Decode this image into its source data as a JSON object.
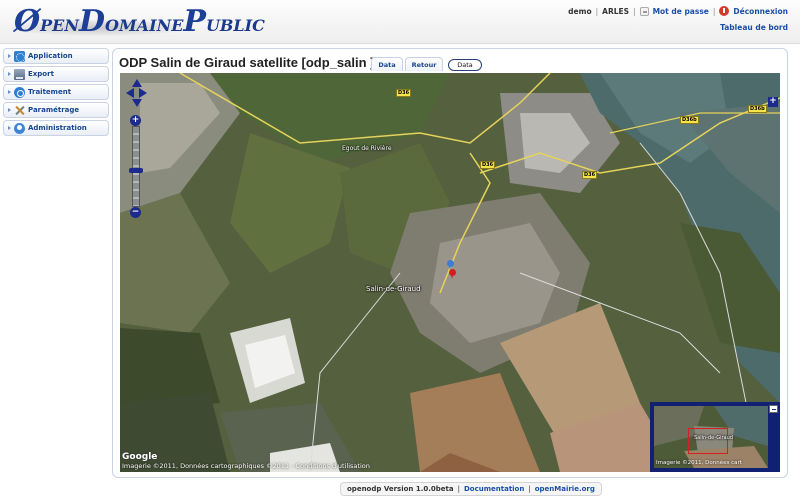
{
  "header": {
    "logo_text": "ØpenDomainePublic",
    "user": "demo",
    "city": "ARLES",
    "password_link": "Mot de passe",
    "logout_link": "Déconnexion",
    "dashboard_link": "Tableau de bord"
  },
  "sidebar": {
    "items": [
      {
        "label": "Application",
        "icon": "application-icon"
      },
      {
        "label": "Export",
        "icon": "export-icon"
      },
      {
        "label": "Traitement",
        "icon": "traitement-icon"
      },
      {
        "label": "Paramétrage",
        "icon": "tools-icon"
      },
      {
        "label": "Administration",
        "icon": "admin-icon"
      }
    ]
  },
  "main": {
    "title": "ODP Salin de Giraud satellite [odp_salin ]",
    "tabs": [
      {
        "label": "Data"
      },
      {
        "label": "Retour"
      }
    ],
    "data_button": "Data"
  },
  "map": {
    "road_labels": [
      "D36",
      "D36",
      "D36",
      "D36",
      "D36b",
      "D36b"
    ],
    "place_labels": [
      "Salin-de-Giraud",
      "Egout de Rivière"
    ],
    "attribution": "Imagerie ©2011, Données cartographiques ©2011 - Conditions d'utilisation",
    "google": "Google",
    "overview": {
      "place": "Salin-de-Giraud",
      "attribution": "Imagerie ©2011, Données cart"
    },
    "zoom_in": "+",
    "zoom_out": "−",
    "layer_switcher": "+"
  },
  "footer": {
    "version": "openodp Version 1.0.0beta",
    "doc_link": "Documentation",
    "mairie_link": "openMairie.org"
  }
}
